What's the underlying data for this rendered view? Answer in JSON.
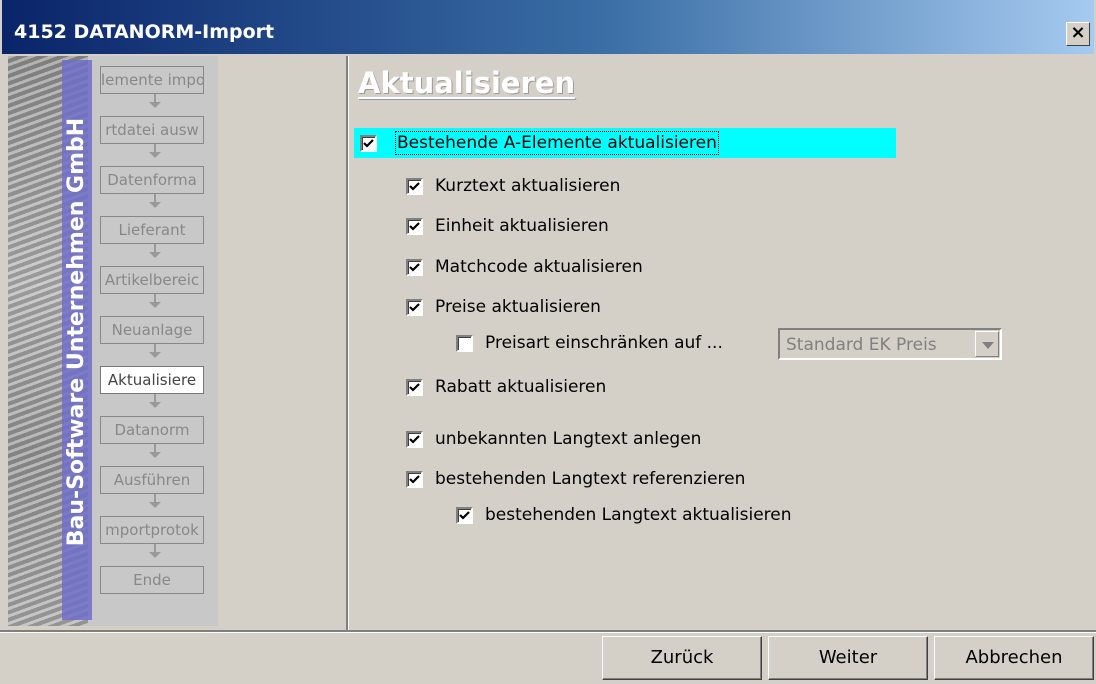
{
  "window": {
    "title": "4152 DATANORM-Import",
    "close_label": "×"
  },
  "sidebar": {
    "brand": "Bau-Software Unternehmen GmbH",
    "steps": [
      "lemente impo",
      "rtdatei ausw",
      "Datenforma",
      "Lieferant",
      "Artikelbereic",
      "Neuanlage",
      "Aktualisiere",
      "Datanorm",
      "Ausführen",
      "mportprotok",
      "Ende"
    ],
    "active_index": 6
  },
  "main": {
    "heading": "Aktualisieren",
    "options": {
      "master": {
        "label": "Bestehende A-Elemente aktualisieren",
        "checked": true
      },
      "kurztext": {
        "label": "Kurztext aktualisieren",
        "checked": true
      },
      "einheit": {
        "label": "Einheit aktualisieren",
        "checked": true
      },
      "matchcode": {
        "label": "Matchcode aktualisieren",
        "checked": true
      },
      "preise": {
        "label": "Preise aktualisieren",
        "checked": true
      },
      "preisart": {
        "label": "Preisart einschränken auf ...",
        "checked": false
      },
      "rabatt": {
        "label": "Rabatt aktualisieren",
        "checked": true
      },
      "langtext_anlegen": {
        "label": "unbekannten Langtext anlegen",
        "checked": true
      },
      "langtext_referenzieren": {
        "label": "bestehenden Langtext referenzieren",
        "checked": true
      },
      "langtext_aktualisieren": {
        "label": "bestehenden Langtext aktualisieren",
        "checked": true
      }
    },
    "price_type_select": {
      "value": "Standard EK Preis"
    }
  },
  "buttons": {
    "back": "Zurück",
    "next": "Weiter",
    "cancel": "Abbrechen"
  },
  "colors": {
    "highlight": "#00ffff",
    "brand_band": "#6e6ec8",
    "titlebar_start": "#0a246a"
  }
}
